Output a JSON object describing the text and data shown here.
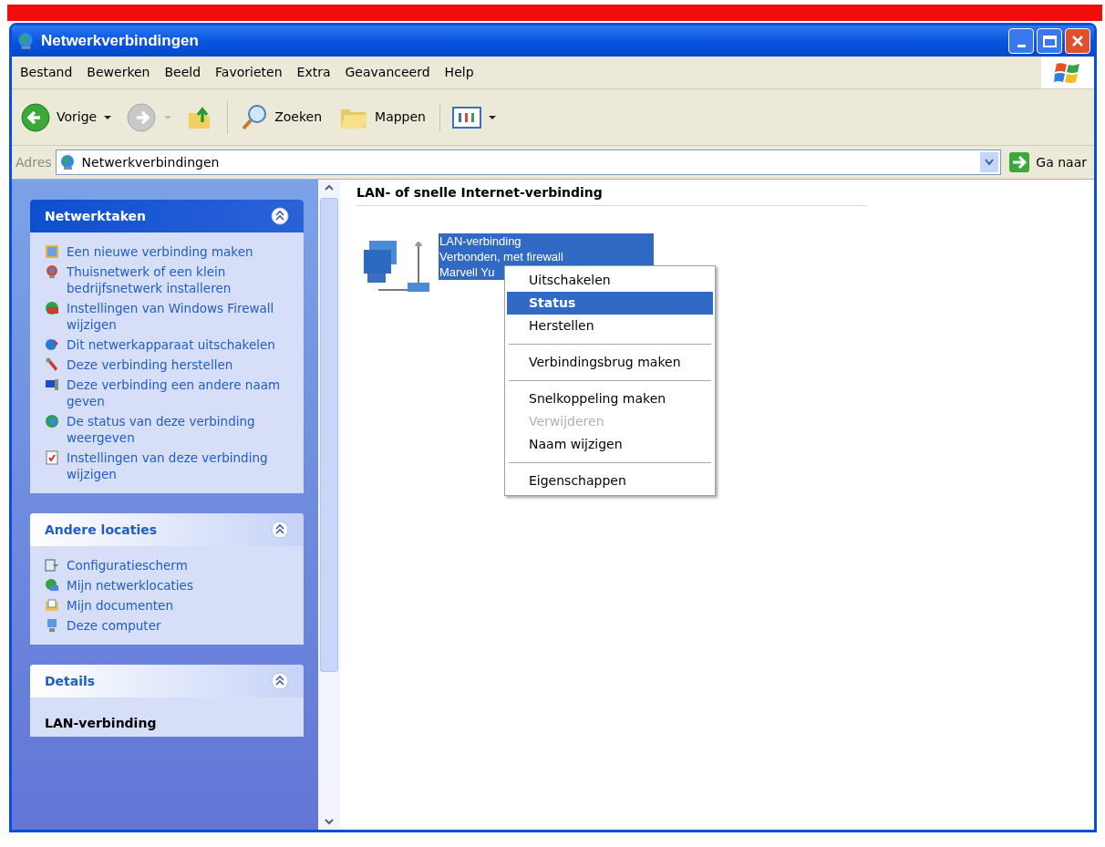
{
  "window": {
    "title": "Netwerkverbindingen"
  },
  "menu_bar": [
    "Bestand",
    "Bewerken",
    "Beeld",
    "Favorieten",
    "Extra",
    "Geavanceerd",
    "Help"
  ],
  "toolbar": [
    {
      "kind": "back",
      "label": "Vorige",
      "disabled": false
    },
    {
      "kind": "forward",
      "disabled": true
    },
    {
      "kind": "up"
    },
    {
      "kind": "search",
      "label": "Zoeken",
      "disabled": false
    },
    {
      "kind": "folders",
      "label": "Mappen",
      "disabled": false
    },
    {
      "kind": "views"
    }
  ],
  "address_bar": {
    "label": "Adres",
    "value": "Netwerkverbindingen",
    "go_label": "Ga naar"
  },
  "sidebar": [
    {
      "kind": "tasks",
      "title": "Netwerktaken",
      "expanded": true,
      "items": [
        "Een nieuwe verbinding maken",
        "Thuisnetwerk of een klein bedrijfsnetwerk installeren",
        "Instellingen van Windows Firewall wijzigen",
        "Dit netwerkapparaat uitschakelen",
        "Deze verbinding herstellen",
        "Deze verbinding een andere naam geven",
        "De status van deze verbinding weergeven",
        "Instellingen van deze verbinding wijzigen"
      ]
    },
    {
      "kind": "links",
      "title": "Andere locaties",
      "expanded": true,
      "items": [
        "Configuratiescherm",
        "Mijn netwerklocaties",
        "Mijn documenten",
        "Deze computer"
      ]
    },
    {
      "kind": "details",
      "title": "Details",
      "expanded": true,
      "items": [
        "LAN-verbinding"
      ]
    }
  ],
  "group_heading": "LAN- of snelle Internet-verbinding",
  "connection": {
    "selected": true,
    "lines": [
      "LAN-verbinding",
      "Verbonden, met firewall",
      "Marvell Yu"
    ]
  },
  "context_menu": [
    {
      "kind": "item",
      "label": "Uitschakelen",
      "selected": false,
      "default": false,
      "disabled": false
    },
    {
      "kind": "item",
      "label": "Status",
      "selected": true,
      "default": true,
      "disabled": false
    },
    {
      "kind": "item",
      "label": "Herstellen",
      "selected": false,
      "default": false,
      "disabled": false
    },
    {
      "kind": "separator"
    },
    {
      "kind": "item",
      "label": "Verbindingsbrug maken",
      "selected": false,
      "default": false,
      "disabled": false
    },
    {
      "kind": "separator"
    },
    {
      "kind": "item",
      "label": "Snelkoppeling maken",
      "selected": false,
      "default": false,
      "disabled": false
    },
    {
      "kind": "item",
      "label": "Verwijderen",
      "selected": false,
      "default": false,
      "disabled": true
    },
    {
      "kind": "item",
      "label": "Naam wijzigen",
      "selected": false,
      "default": false,
      "disabled": false
    },
    {
      "kind": "separator"
    },
    {
      "kind": "item",
      "label": "Eigenschappen",
      "selected": false,
      "default": false,
      "disabled": false
    }
  ]
}
